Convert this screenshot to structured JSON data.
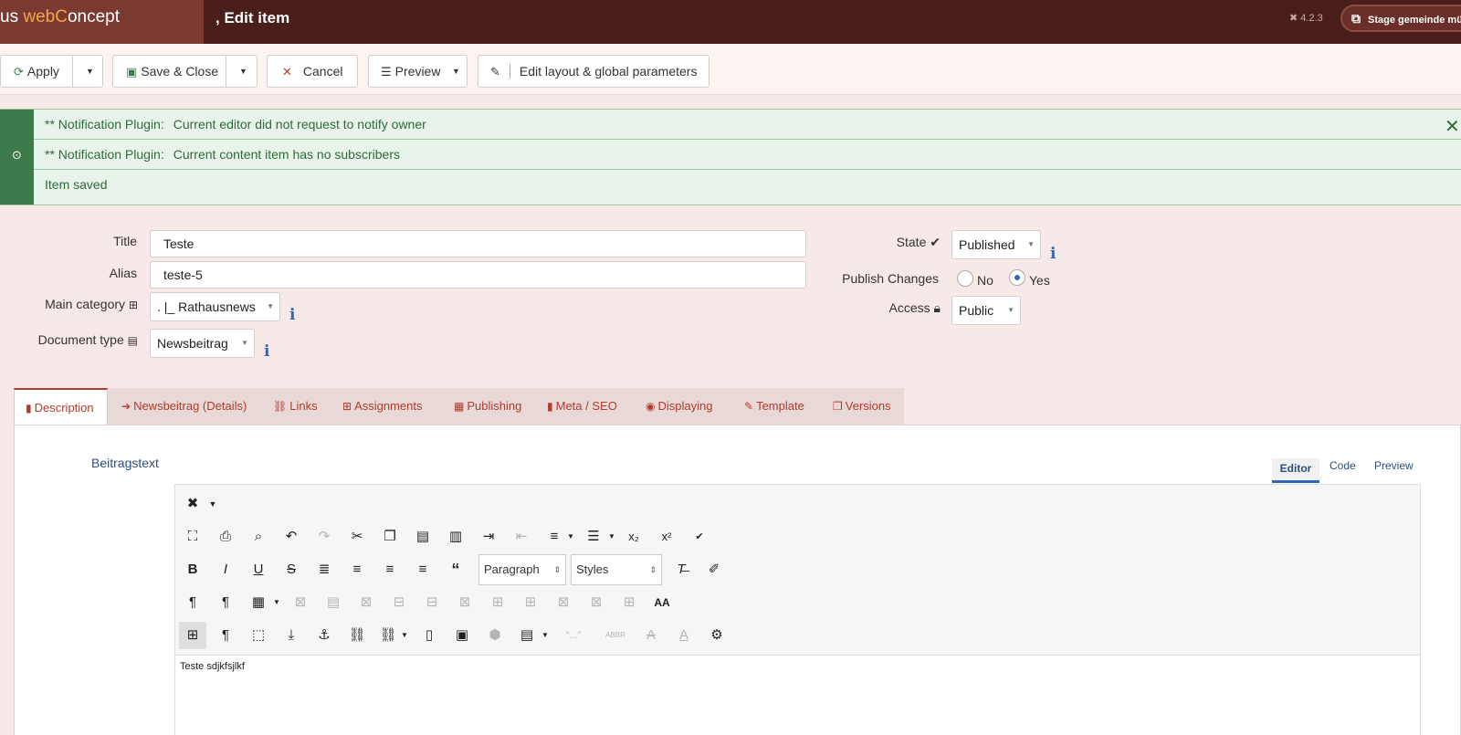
{
  "header": {
    "brand_prefix": "us ",
    "brand_web": "web",
    "brand_c": "C",
    "brand_rest": "oncept",
    "page_title": ", Edit item",
    "version": "4.2.3",
    "stage_button": "Stage gemeinde mü"
  },
  "toolbar": {
    "apply": "Apply",
    "save_close": "Save & Close",
    "cancel": "Cancel",
    "preview": "Preview",
    "edit_layout": "Edit layout & global parameters"
  },
  "alerts": [
    {
      "label": "** Notification Plugin:",
      "text": "Current editor did not request to notify owner"
    },
    {
      "label": "** Notification Plugin:",
      "text": "Current content item has no subscribers"
    },
    {
      "label": "",
      "text": "Item saved"
    }
  ],
  "form": {
    "title_label": "Title",
    "title_value": "Teste",
    "alias_label": "Alias",
    "alias_value": "teste-5",
    "category_label": "Main category",
    "category_value": ". |_ Rathausnews",
    "doctype_label": "Document type",
    "doctype_value": "Newsbeitrag",
    "state_label": "State",
    "state_value": "Published",
    "publish_changes_label": "Publish Changes",
    "publish_no": "No",
    "publish_yes": "Yes",
    "publish_selected": "Yes",
    "access_label": "Access",
    "access_value": "Public"
  },
  "tabs": [
    {
      "label": "Description",
      "icon": "file-icon",
      "active": true
    },
    {
      "label": "Newsbeitrag (Details)",
      "icon": "sign-in-icon"
    },
    {
      "label": "Links",
      "icon": "link-icon"
    },
    {
      "label": "Assignments",
      "icon": "sitemap-icon"
    },
    {
      "label": "Publishing",
      "icon": "calendar-icon"
    },
    {
      "label": "Meta / SEO",
      "icon": "bookmark-icon"
    },
    {
      "label": "Displaying",
      "icon": "eye-icon"
    },
    {
      "label": "Template",
      "icon": "brush-icon"
    },
    {
      "label": "Versions",
      "icon": "copy-icon"
    }
  ],
  "editor": {
    "field_label": "Beitragstext",
    "modes": [
      "Editor",
      "Code",
      "Preview"
    ],
    "active_mode": "Editor",
    "format_select": "Paragraph",
    "styles_select": "Styles",
    "content": "Teste sdjkfsjlkf"
  },
  "colors": {
    "header_bg": "#4a1e1a",
    "accent": "#b23a2e",
    "success_bg": "#e8f4ea",
    "info_blue": "#2f68b8"
  }
}
